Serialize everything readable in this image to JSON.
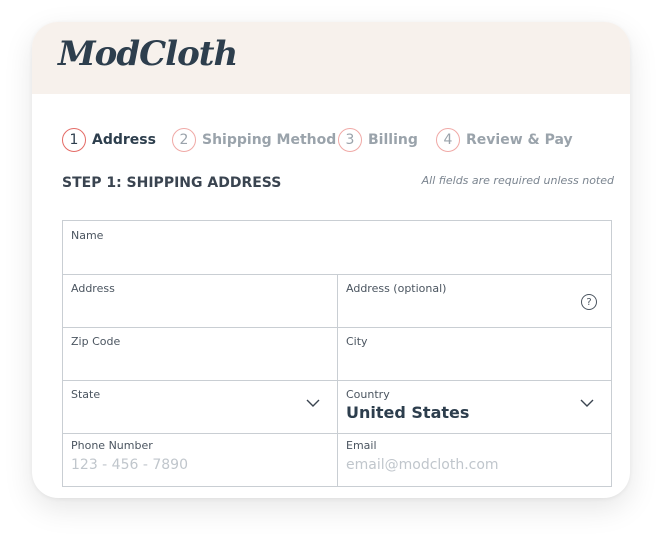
{
  "brand": {
    "logo_text": "ModCloth"
  },
  "steps": [
    {
      "num": "1",
      "label": "Address"
    },
    {
      "num": "2",
      "label": "Shipping Method"
    },
    {
      "num": "3",
      "label": "Billing"
    },
    {
      "num": "4",
      "label": "Review & Pay"
    }
  ],
  "section": {
    "title": "STEP 1: SHIPPING ADDRESS",
    "note": "All fields are required unless noted"
  },
  "form": {
    "name_label": "Name",
    "address_label": "Address",
    "address2_label": "Address (optional)",
    "help_glyph": "?",
    "zip_label": "Zip Code",
    "city_label": "City",
    "state_label": "State",
    "country_label": "Country",
    "country_value": "United States",
    "phone_label": "Phone Number",
    "phone_placeholder": "123 - 456 - 7890",
    "email_label": "Email",
    "email_placeholder": "email@modcloth.com"
  },
  "colors": {
    "header_bg": "#f7f1ec",
    "step_circle_active": "#e46b66",
    "step_circle": "#f0a9a6",
    "text_dark": "#2d3e4d"
  }
}
